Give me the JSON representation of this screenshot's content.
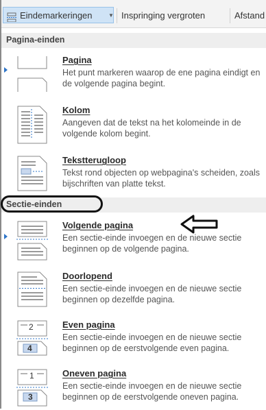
{
  "toolbar": {
    "breaks_label": "Eindemarkeringen",
    "indent_label": "Inspringing vergroten",
    "spacing_label": "Afstand"
  },
  "sections": {
    "page_breaks": "Pagina-einden",
    "section_breaks": "Sectie-einden"
  },
  "items": [
    {
      "title": "Pagina",
      "desc": "Het punt markeren waarop de ene pagina eindigt en de volgende pagina begint."
    },
    {
      "title": "Kolom",
      "desc": "Aangeven dat de tekst na het kolomeinde in de volgende kolom begint."
    },
    {
      "title": "Tekstterugloop",
      "desc": "Tekst rond objecten op webpagina's scheiden, zoals bijschriften van platte tekst."
    },
    {
      "title": "Volgende pagina",
      "desc": "Een sectie-einde invoegen en de nieuwe sectie beginnen op de volgende pagina."
    },
    {
      "title": "Doorlopend",
      "desc": "Een sectie-einde invoegen en de nieuwe sectie beginnen op dezelfde pagina."
    },
    {
      "title": "Even pagina",
      "desc": "Een sectie-einde invoegen en de nieuwe sectie beginnen op de eerstvolgende even pagina."
    },
    {
      "title": "Oneven pagina",
      "desc": "Een sectie-einde invoegen en de nieuwe sectie beginnen op de eerstvolgende oneven pagina."
    }
  ],
  "thumb_numbers": {
    "even_top": "2",
    "even_bottom": "4",
    "odd_top": "1",
    "odd_bottom": "3"
  },
  "colors": {
    "accent": "#2e75c8",
    "active_button": "#cfe3f6",
    "annotation": "#111111"
  },
  "icons": [
    "breaks-icon",
    "page-break-icon",
    "column-break-icon",
    "text-wrapping-icon",
    "next-page-icon",
    "continuous-icon",
    "even-page-icon",
    "odd-page-icon",
    "arrow-left-annotation-icon"
  ]
}
